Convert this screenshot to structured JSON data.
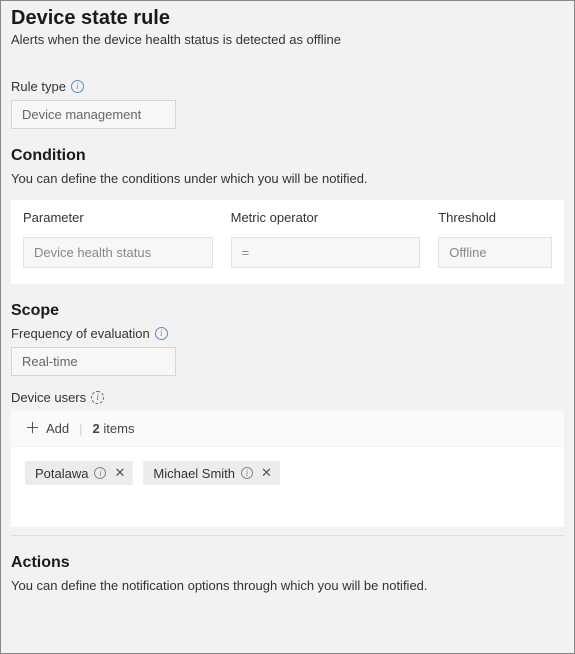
{
  "header": {
    "title": "Device state rule",
    "subtitle": "Alerts when the device health status is detected as offline"
  },
  "ruleType": {
    "label": "Rule type",
    "value": "Device management"
  },
  "condition": {
    "heading": "Condition",
    "description": "You can define the conditions under which you will be notified.",
    "columns": {
      "parameter": "Parameter",
      "operator": "Metric operator",
      "threshold": "Threshold"
    },
    "values": {
      "parameter": "Device health status",
      "operator": "=",
      "threshold": "Offline"
    }
  },
  "scope": {
    "heading": "Scope",
    "frequencyLabel": "Frequency of evaluation",
    "frequencyValue": "Real-time",
    "usersLabel": "Device users",
    "addLabel": "Add",
    "itemsCount": "2",
    "itemsWord": "items",
    "users": [
      {
        "name": "Potalawa"
      },
      {
        "name": "Michael Smith"
      }
    ]
  },
  "actions": {
    "heading": "Actions",
    "description": "You can define the notification options through which you will be notified."
  }
}
